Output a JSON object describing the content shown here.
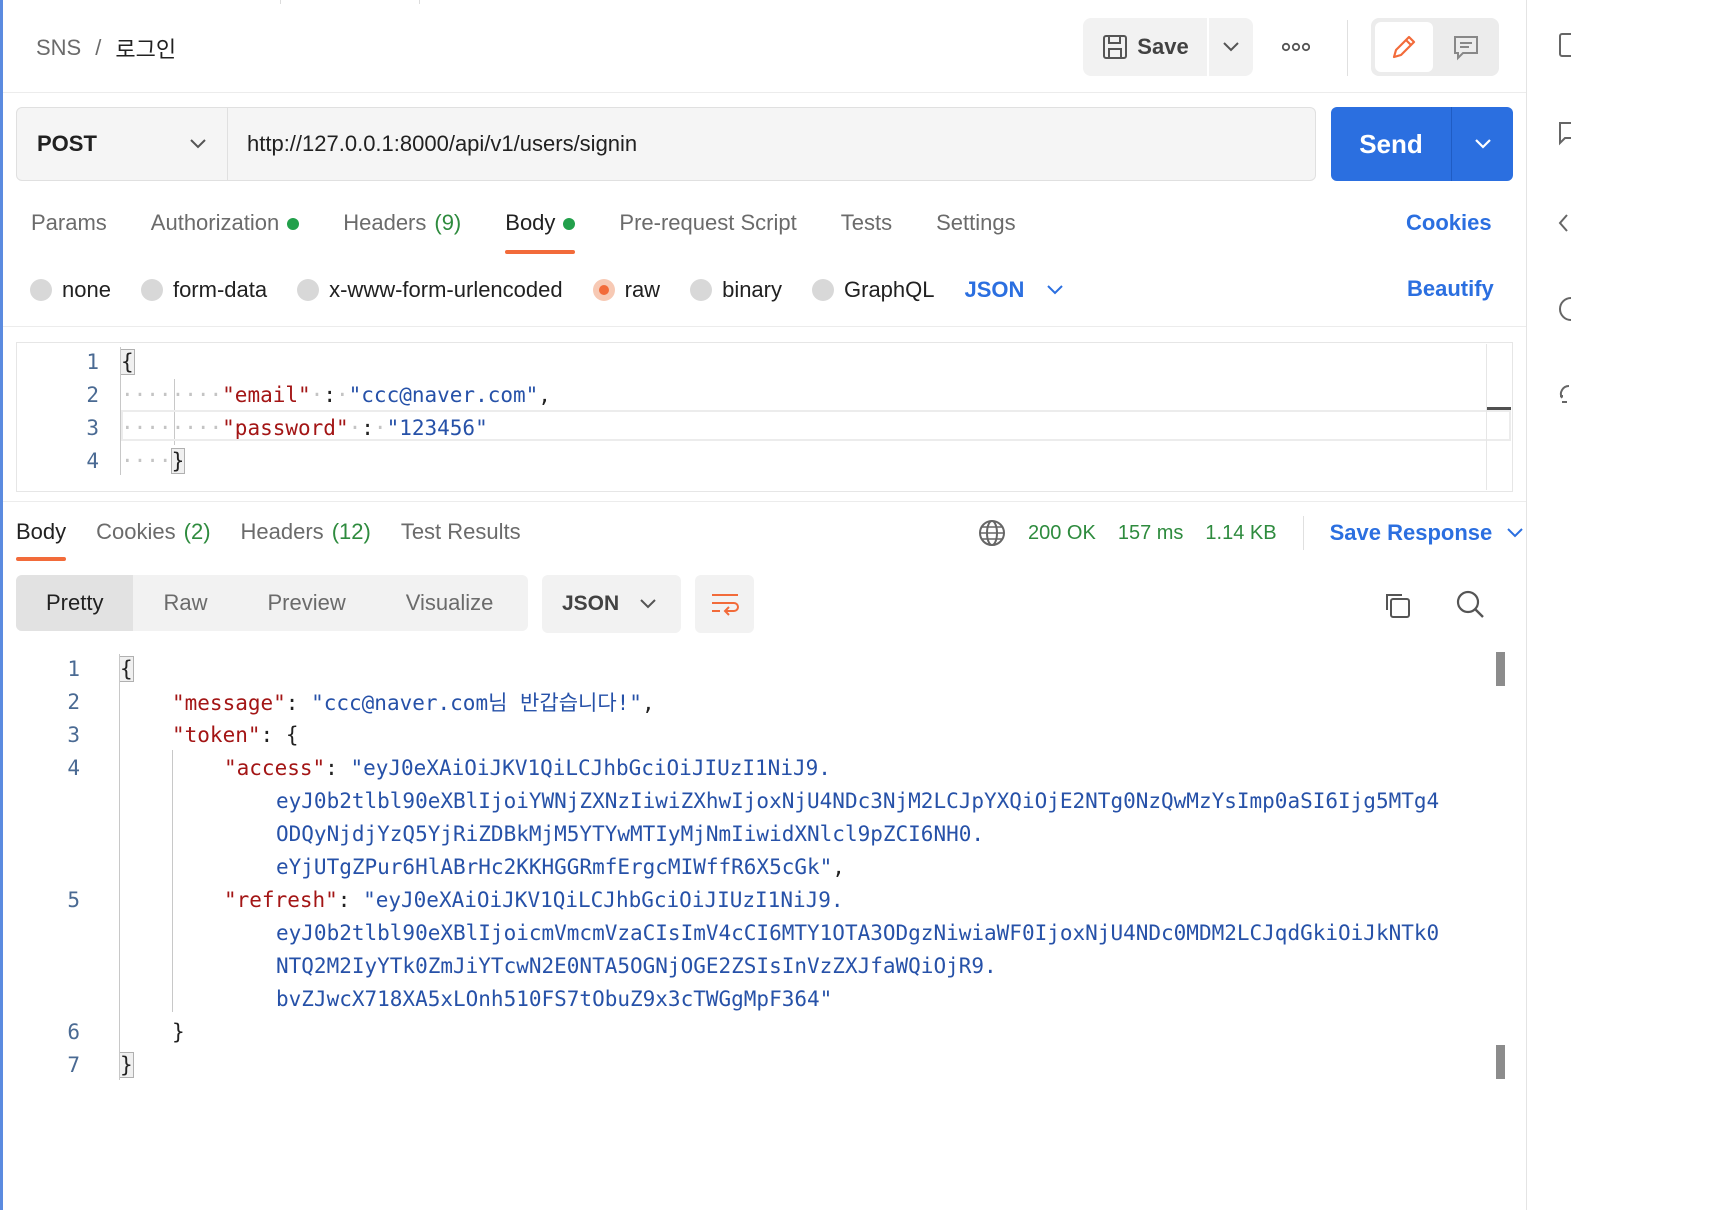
{
  "breadcrumb": {
    "parent": "SNS",
    "separator": "/",
    "current": "로그인"
  },
  "toolbar": {
    "save_label": "Save"
  },
  "request": {
    "method": "POST",
    "url": "http://127.0.0.1:8000/api/v1/users/signin",
    "send_label": "Send"
  },
  "request_tabs": [
    {
      "label": "Params",
      "count": "",
      "dot": false,
      "active": false
    },
    {
      "label": "Authorization",
      "count": "",
      "dot": true,
      "active": false
    },
    {
      "label": "Headers",
      "count": "(9)",
      "dot": false,
      "active": false
    },
    {
      "label": "Body",
      "count": "",
      "dot": true,
      "active": true
    },
    {
      "label": "Pre-request Script",
      "count": "",
      "dot": false,
      "active": false
    },
    {
      "label": "Tests",
      "count": "",
      "dot": false,
      "active": false
    },
    {
      "label": "Settings",
      "count": "",
      "dot": false,
      "active": false
    }
  ],
  "cookies_link": "Cookies",
  "body_types": [
    "none",
    "form-data",
    "x-www-form-urlencoded",
    "raw",
    "binary",
    "GraphQL"
  ],
  "body_type_selected": "raw",
  "body_format": "JSON",
  "beautify_label": "Beautify",
  "request_body": {
    "line_numbers": [
      "1",
      "2",
      "3",
      "4"
    ],
    "open_brace": "{",
    "close_brace": "}",
    "email_key": "\"email\"",
    "email_value": "\"ccc@naver.com\"",
    "password_key": "\"password\"",
    "password_value": "\"123456\""
  },
  "response_tabs": [
    {
      "label": "Body",
      "count": "",
      "active": true
    },
    {
      "label": "Cookies",
      "count": "(2)",
      "active": false
    },
    {
      "label": "Headers",
      "count": "(12)",
      "active": false
    },
    {
      "label": "Test Results",
      "count": "",
      "active": false
    }
  ],
  "response_status": {
    "code": "200 OK",
    "time": "157 ms",
    "size": "1.14 KB"
  },
  "save_response_label": "Save Response",
  "view_modes": [
    "Pretty",
    "Raw",
    "Preview",
    "Visualize"
  ],
  "view_mode_selected": "Pretty",
  "response_format": "JSON",
  "response_body": {
    "line_numbers": [
      "1",
      "2",
      "3",
      "4",
      "5",
      "6",
      "7"
    ],
    "open_brace": "{",
    "close_brace": "}",
    "message_key": "\"message\"",
    "message_value": "\"ccc@naver.com님 반갑습니다!\"",
    "token_key": "\"token\"",
    "access_key": "\"access\"",
    "access_value": [
      "\"eyJ0eXAiOiJKV1QiLCJhbGciOiJIUzI1NiJ9.",
      "eyJ0b2tlbl90eXBlIjoiYWNjZXNzIiwiZXhwIjoxNjU4NDc3NjM2LCJpYXQiOjE2NTg0NzQwMzYsImp0aSI6Ijg5MTg4",
      "ODQyNjdjYzQ5YjRiZDBkMjM5YTYwMTIyMjNmIiwidXNlcl9pZCI6NH0.",
      "eYjUTgZPur6HlABrHc2KKHGGRmfErgcMIWffR6X5cGk\""
    ],
    "refresh_key": "\"refresh\"",
    "refresh_value": [
      "\"eyJ0eXAiOiJKV1QiLCJhbGciOiJIUzI1NiJ9.",
      "eyJ0b2tlbl90eXBlIjoicmVmcmVzaCIsImV4cCI6MTY1OTA3ODgzNiwiaWF0IjoxNjU4NDc0MDM2LCJqdGkiOiJkNTk0",
      "NTQ2M2IyYTk0ZmJiYTcwN2E0NTA5OGNjOGE2ZSIsInVzZXJfaWQiOjR9.",
      "bvZJwcX718XA5xLOnh510FS7tObuZ9x3cTWGgMpF364\""
    ]
  },
  "colors": {
    "accent_blue": "#2b6fe0",
    "accent_orange": "#f26b3a",
    "status_green": "#2e8b3e",
    "json_key": "#a31515",
    "json_string": "#2651a8"
  }
}
